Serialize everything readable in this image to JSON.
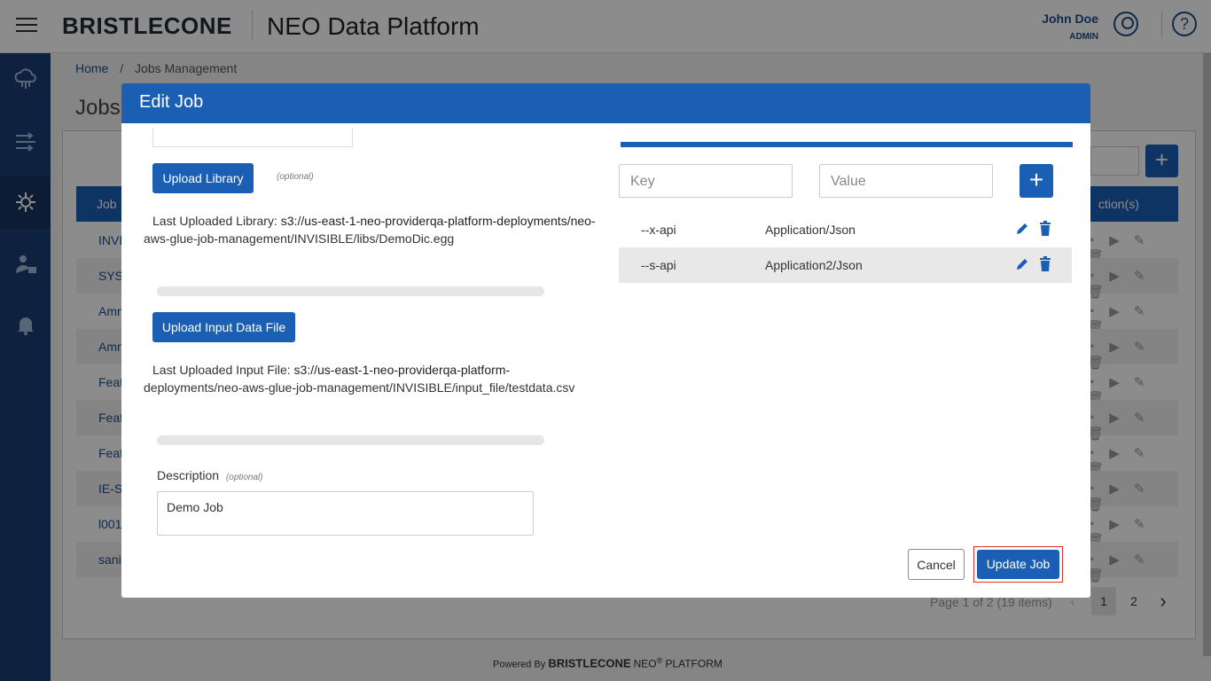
{
  "header": {
    "logo": "BRISTLECONE",
    "app_title": "NEO Data Platform",
    "user_name": "John Doe",
    "user_role": "ADMIN",
    "help_glyph": "?"
  },
  "sidebar": {
    "items": [
      {
        "icon": "cloud-network-icon"
      },
      {
        "icon": "data-flow-icon"
      },
      {
        "icon": "settings-tools-icon",
        "active": true
      },
      {
        "icon": "user-admin-icon"
      },
      {
        "icon": "bell-icon"
      }
    ]
  },
  "breadcrumb": {
    "home": "Home",
    "separator": "/",
    "current": "Jobs Management"
  },
  "background": {
    "page_title": "Jobs",
    "add_glyph": "+",
    "table_headers": [
      "Job",
      "ction(s)"
    ],
    "rows": [
      "INVI",
      "SYS-",
      "Amn",
      "Amn",
      "Feat",
      "Feat",
      "Feat",
      "IE-Si",
      "l001",
      "sani"
    ],
    "row_action_glyphs": "◔ ▶ ✎ 🗑",
    "pager_text": "Page 1 of 2 (19 items)",
    "pages": [
      "1",
      "2"
    ],
    "pager_prev": "‹",
    "pager_next": "›"
  },
  "footer": {
    "powered_by": "Powered By",
    "brand": "BRISTLECONE",
    "product": "NEO",
    "registered": "®",
    "suffix": "PLATFORM"
  },
  "modal": {
    "title": "Edit Job",
    "upload_library_label": "Upload Library",
    "optional_label": "(optional)",
    "last_library_prefix": "Last Uploaded Library:",
    "last_library_path_line1": "s3://us-east-1-neo-providerqa-platform-deployments/neo-",
    "last_library_path_line2": "aws-glue-job-management/INVISIBLE/libs/DemoDic.egg",
    "upload_input_label": "Upload Input Data File",
    "last_input_prefix": "Last Uploaded Input File:",
    "last_input_path_line1": "s3://us-east-1-neo-providerqa-platform-",
    "last_input_path_line2": "deployments/neo-aws-glue-job-management/INVISIBLE/input_file/testdata.csv",
    "description_label": "Description",
    "description_optional": "(optional)",
    "description_value": "Demo Job",
    "key_placeholder": "Key",
    "value_placeholder": "Value",
    "add_param_glyph": "+",
    "params": [
      {
        "key": "--x-api",
        "value": "Application/Json"
      },
      {
        "key": "--s-api",
        "value": "Application2/Json"
      }
    ],
    "cancel_label": "Cancel",
    "update_label": "Update Job"
  },
  "colors": {
    "primary": "#1a5fb4",
    "sidebar": "#1a3f75",
    "highlight_border": "#e0302a"
  }
}
